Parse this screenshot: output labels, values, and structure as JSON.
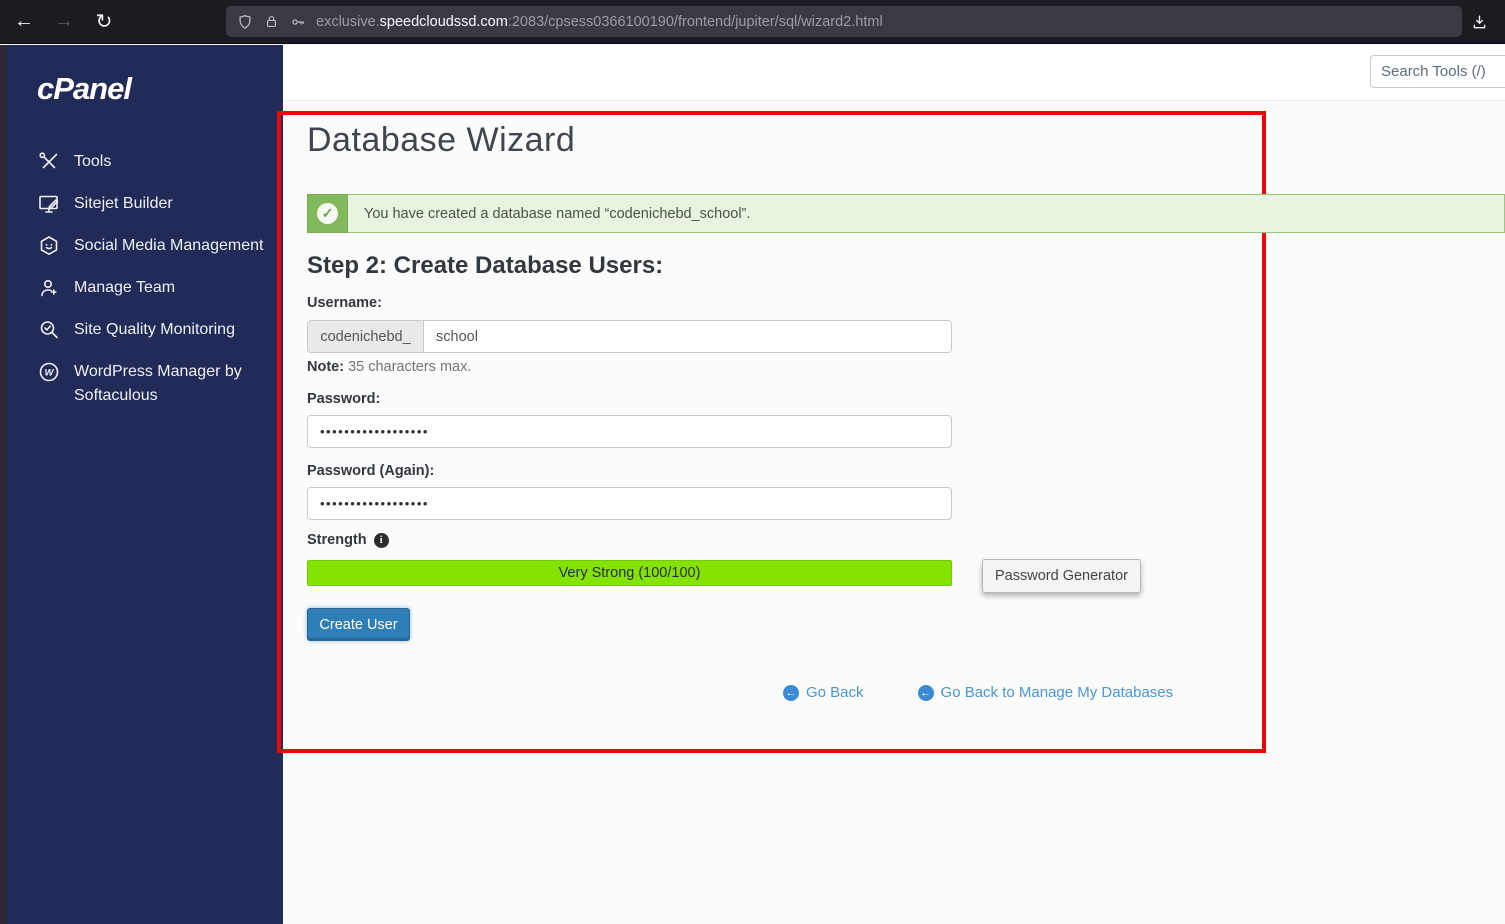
{
  "browser": {
    "url": {
      "subdomain": "exclusive.",
      "domain": "speedcloudssd.com",
      "path": ":2083/cpsess0366100190/frontend/jupiter/sql/wizard2.html"
    }
  },
  "sidebar": {
    "logo_text": "cPanel",
    "items": [
      {
        "label": "Tools",
        "icon": "tools-icon"
      },
      {
        "label": "Sitejet Builder",
        "icon": "sitejet-builder-icon"
      },
      {
        "label": "Social Media Management",
        "icon": "social-media-icon"
      },
      {
        "label": "Manage Team",
        "icon": "manage-team-icon"
      },
      {
        "label": "Site Quality Monitoring",
        "icon": "site-quality-icon"
      },
      {
        "label": "WordPress Manager by Softaculous",
        "icon": "wordpress-icon"
      }
    ]
  },
  "header": {
    "search_placeholder": "Search Tools (/)"
  },
  "main": {
    "title": "Database Wizard",
    "success_alert": "You have created a database named “codenichebd_school”.",
    "step_heading": "Step 2: Create Database Users:",
    "username_label": "Username:",
    "username_prefix": "codenichebd_",
    "username_value": "school",
    "note_label": "Note:",
    "note_text": "35 characters max.",
    "password_label": "Password:",
    "password_value": "••••••••••••••••••",
    "password_again_label": "Password (Again):",
    "password_again_value": "••••••••••••••••••",
    "strength_label": "Strength",
    "strength_bar_text": "Very Strong (100/100)",
    "password_generator_label": "Password Generator",
    "create_user_label": "Create User",
    "go_back_label": "Go Back",
    "go_back_manage_label": "Go Back to Manage My Databases"
  },
  "colors": {
    "sidebar_bg": "#222b57",
    "alert_green": "#81b95c",
    "alert_bg": "#e9f4e0",
    "strength_green": "#84e300",
    "button_blue": "#2f7eb7",
    "link_blue": "#4a97d2",
    "annotation_red": "#ee0202"
  }
}
